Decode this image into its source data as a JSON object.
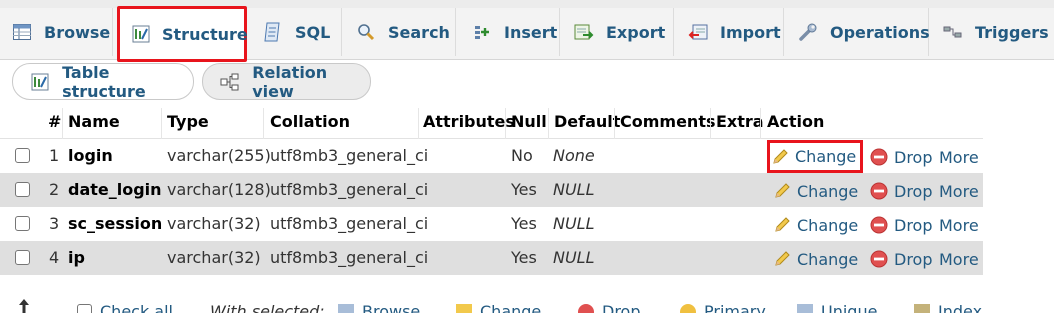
{
  "tabs": [
    {
      "label": "Browse",
      "icon": "table-browse-icon"
    },
    {
      "label": "Structure",
      "icon": "structure-icon"
    },
    {
      "label": "SQL",
      "icon": "sql-icon"
    },
    {
      "label": "Search",
      "icon": "search-icon"
    },
    {
      "label": "Insert",
      "icon": "insert-icon"
    },
    {
      "label": "Export",
      "icon": "export-icon"
    },
    {
      "label": "Import",
      "icon": "import-icon"
    },
    {
      "label": "Operations",
      "icon": "wrench-icon"
    },
    {
      "label": "Triggers",
      "icon": "triggers-icon"
    }
  ],
  "active_tab": "Structure",
  "subtabs": {
    "table_structure": "Table structure",
    "relation_view": "Relation view"
  },
  "table": {
    "headers": {
      "num": "#",
      "name": "Name",
      "type": "Type",
      "collation": "Collation",
      "attributes": "Attributes",
      "null": "Null",
      "default": "Default",
      "comments": "Comments",
      "extra": "Extra",
      "action": "Action"
    },
    "rows": [
      {
        "num": "1",
        "name": "login",
        "type": "varchar(255)",
        "collation": "utf8mb3_general_ci",
        "null": "No",
        "default": "None"
      },
      {
        "num": "2",
        "name": "date_login",
        "type": "varchar(128)",
        "collation": "utf8mb3_general_ci",
        "null": "Yes",
        "default": "NULL"
      },
      {
        "num": "3",
        "name": "sc_session",
        "type": "varchar(32)",
        "collation": "utf8mb3_general_ci",
        "null": "Yes",
        "default": "NULL"
      },
      {
        "num": "4",
        "name": "ip",
        "type": "varchar(32)",
        "collation": "utf8mb3_general_ci",
        "null": "Yes",
        "default": "NULL"
      }
    ],
    "actions": {
      "change": "Change",
      "drop": "Drop",
      "more": "More"
    }
  },
  "bottom_bar": {
    "check_all": "Check all",
    "with_selected": "With selected:",
    "browse": "Browse",
    "change": "Change",
    "drop": "Drop",
    "primary": "Primary",
    "unique": "Unique",
    "index": "Index"
  },
  "colors": {
    "link": "#235a81",
    "highlight_border": "#e8141c",
    "row_even": "#dfdfdf"
  }
}
